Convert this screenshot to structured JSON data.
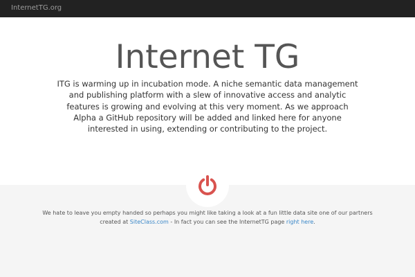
{
  "navbar": {
    "brand": "InternetTG.org"
  },
  "hero": {
    "title": "Internet TG",
    "description": "ITG is warming up in incubation mode. A niche semantic data management and publishing platform with a slew of innovative access and analytic features is growing and evolving at this very moment. As we approach Alpha a GitHub repository will be added and linked here for anyone interested in using, extending or contributing to the project."
  },
  "icon": {
    "name": "power-icon",
    "color": "#d9534f"
  },
  "footer": {
    "text_before": "We hate to leave you empty handed so perhaps you might like taking a look at a fun little data site one of our partners created at ",
    "link1_label": "SiteClass.com",
    "text_middle": " - In fact you can see the InternetTG page ",
    "link2_label": "right here",
    "text_after": "."
  },
  "colors": {
    "navbar_bg": "#222222",
    "link": "#3a87c8",
    "accent": "#d9534f"
  }
}
